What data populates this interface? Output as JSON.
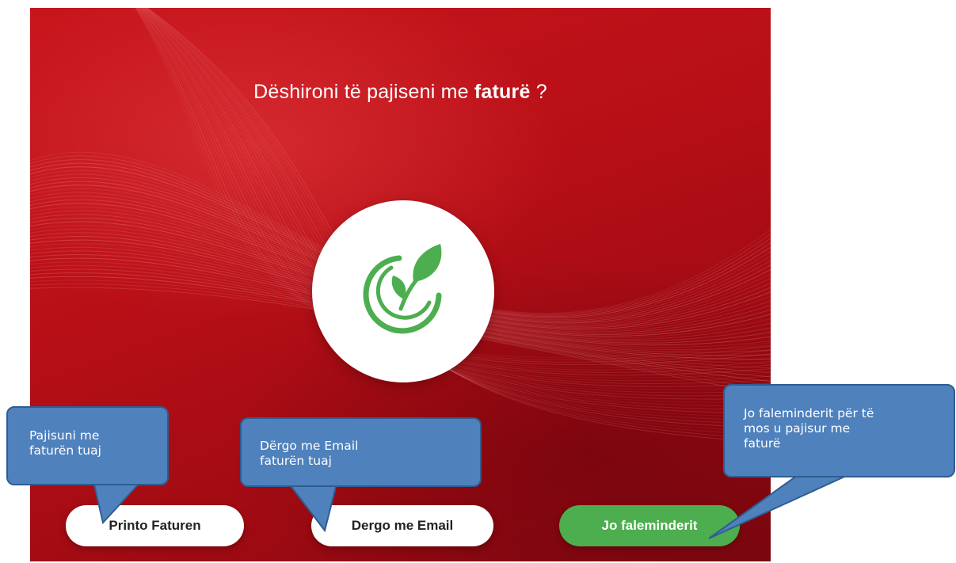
{
  "screen": {
    "question_prefix": "Dëshironi të pajiseni me",
    "question_bold": "faturë",
    "question_suffix": "?"
  },
  "buttons": {
    "print_label": "Printo Faturen",
    "email_label": "Dergo me Email",
    "decline_label": "Jo faleminderit"
  },
  "callouts": {
    "print": [
      "Pajisuni me",
      "faturën tuaj"
    ],
    "email": [
      "Dërgo me Email",
      "faturën tuaj"
    ],
    "decline": [
      "Jo faleminderit për të",
      "mos u pajisur me",
      "faturë"
    ]
  },
  "icons": {
    "logo": "green-leaf-sprout-icon"
  },
  "colors": {
    "background_red": "#b80f17",
    "accent_green": "#4cae4f",
    "callout_blue": "#4f81bd",
    "callout_border": "#2e5d91"
  }
}
